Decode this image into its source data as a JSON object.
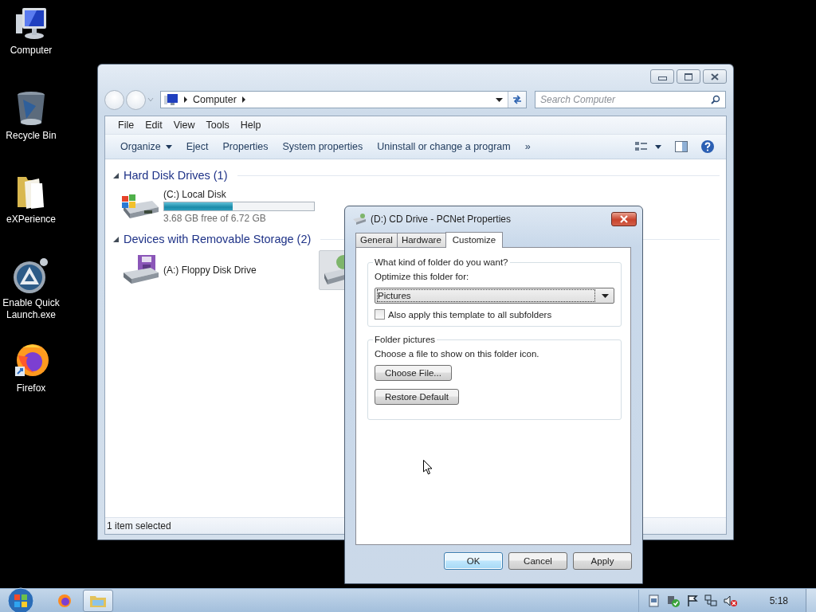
{
  "desktop_icons": [
    {
      "kind": "computer",
      "label": "Computer"
    },
    {
      "kind": "recycle",
      "label": "Recycle Bin"
    },
    {
      "kind": "folder",
      "label": "eXPerience"
    },
    {
      "kind": "launcher",
      "label": "Enable Quick Launch.exe"
    },
    {
      "kind": "browser",
      "label": "Firefox"
    }
  ],
  "explorer": {
    "address": {
      "crumbs": [
        "Computer"
      ]
    },
    "search": {
      "placeholder": "Search Computer"
    },
    "menu": [
      "File",
      "Edit",
      "View",
      "Tools",
      "Help"
    ],
    "commands": [
      {
        "label": "Organize",
        "kind": "menu"
      },
      {
        "label": "Eject",
        "kind": "plain"
      },
      {
        "label": "Properties",
        "kind": "plain"
      },
      {
        "label": "System properties",
        "kind": "plain"
      },
      {
        "label": "Uninstall or change a program",
        "kind": "plain"
      },
      {
        "label": "»",
        "kind": "plain"
      }
    ],
    "groups": [
      {
        "title": "Hard Disk Drives (1)",
        "expanded": true,
        "items": [
          {
            "kind": "disk",
            "name": "(C:) Local Disk",
            "level": 0.46,
            "free": "3.68 GB free of 6.72 GB",
            "selected": false
          }
        ]
      },
      {
        "title": "Devices with Removable Storage (2)",
        "expanded": true,
        "items": [
          {
            "kind": "floppy",
            "name": "(A:) Floppy Disk Drive",
            "selected": false
          },
          {
            "kind": "cd",
            "selected": true
          }
        ]
      }
    ],
    "status_bar": "1 item selected"
  },
  "dialog": {
    "title": "(D:) CD Drive - PCNet Properties",
    "tabs": [
      {
        "label": "General",
        "selected": false
      },
      {
        "label": "Hardware",
        "selected": false
      },
      {
        "label": "Customize",
        "selected": true
      }
    ],
    "folder_type": {
      "legend": "What kind of folder do you want?",
      "label": "Optimize this folder for:",
      "value": "Pictures",
      "checkbox": {
        "label": "Also apply this template to all subfolders",
        "checked": false
      }
    },
    "folder_pictures": {
      "legend": "Folder pictures",
      "text": "Choose a file to show on this folder icon.",
      "buttons": [
        "Choose File...",
        "Restore Default"
      ]
    },
    "buttons": [
      {
        "label": "OK",
        "default": true
      },
      {
        "label": "Cancel",
        "default": false
      },
      {
        "label": "Apply",
        "default": false
      }
    ]
  },
  "taskbar": {
    "pinned": [
      {
        "kind": "browser",
        "selected": false
      },
      {
        "kind": "explorer",
        "selected": true
      }
    ],
    "clock": "5:18"
  }
}
